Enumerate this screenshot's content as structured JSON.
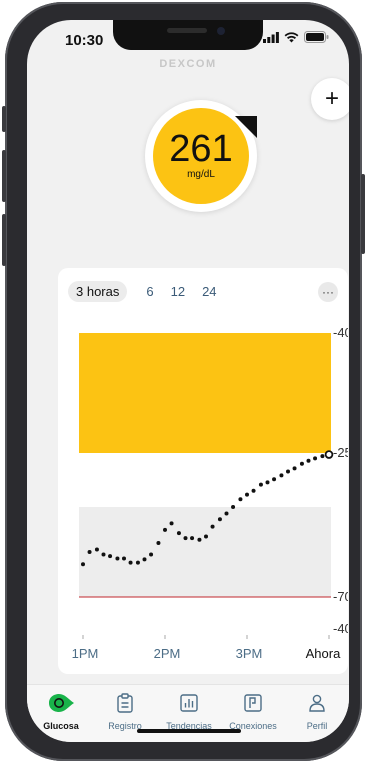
{
  "status_bar": {
    "time": "10:30"
  },
  "brand": "DEXCOM",
  "add_button_label": "+",
  "glucose": {
    "value": "261",
    "unit": "mg/dL",
    "trend_icon": "trend-arrow-icon"
  },
  "time_range_tabs": [
    {
      "label": "3 horas",
      "selected": true
    },
    {
      "label": "6",
      "selected": false
    },
    {
      "label": "12",
      "selected": false
    },
    {
      "label": "24",
      "selected": false
    }
  ],
  "more_label": "···",
  "colors": {
    "high_zone": "#fcc313",
    "in_range_zone": "#ededed",
    "low_line": "#c0272d",
    "accent_green": "#19b34a",
    "nav_text": "#4c6d86"
  },
  "chart_data": {
    "type": "scatter",
    "y_ticks": [
      "400",
      "250",
      "70",
      "40"
    ],
    "x_ticks": [
      "1PM",
      "2PM",
      "3PM",
      "Ahora"
    ],
    "high_threshold": 250,
    "target_range": [
      70,
      180
    ],
    "low_threshold": 70,
    "ylim": [
      40,
      400
    ],
    "x_hours": [
      0,
      0.08,
      0.17,
      0.25,
      0.33,
      0.42,
      0.5,
      0.58,
      0.67,
      0.75,
      0.83,
      0.92,
      1.0,
      1.08,
      1.17,
      1.25,
      1.33,
      1.42,
      1.5,
      1.58,
      1.67,
      1.75,
      1.83,
      1.92,
      2.0,
      2.08,
      2.17,
      2.25,
      2.33,
      2.42,
      2.5,
      2.58,
      2.67,
      2.75,
      2.83,
      2.92,
      3.0
    ],
    "values": [
      110,
      125,
      128,
      122,
      120,
      117,
      117,
      112,
      112,
      116,
      122,
      136,
      152,
      160,
      148,
      142,
      142,
      140,
      144,
      156,
      165,
      172,
      180,
      190,
      196,
      201,
      209,
      212,
      216,
      221,
      226,
      230,
      236,
      240,
      243,
      246,
      248
    ]
  },
  "bottom_nav": [
    {
      "label": "Glucosa",
      "icon": "glucose-drop-icon",
      "active": true
    },
    {
      "label": "Registro",
      "icon": "clipboard-icon",
      "active": false
    },
    {
      "label": "Tendencias",
      "icon": "bar-chart-icon",
      "active": false
    },
    {
      "label": "Conexiones",
      "icon": "connections-icon",
      "active": false
    },
    {
      "label": "Perfil",
      "icon": "person-icon",
      "active": false
    }
  ]
}
